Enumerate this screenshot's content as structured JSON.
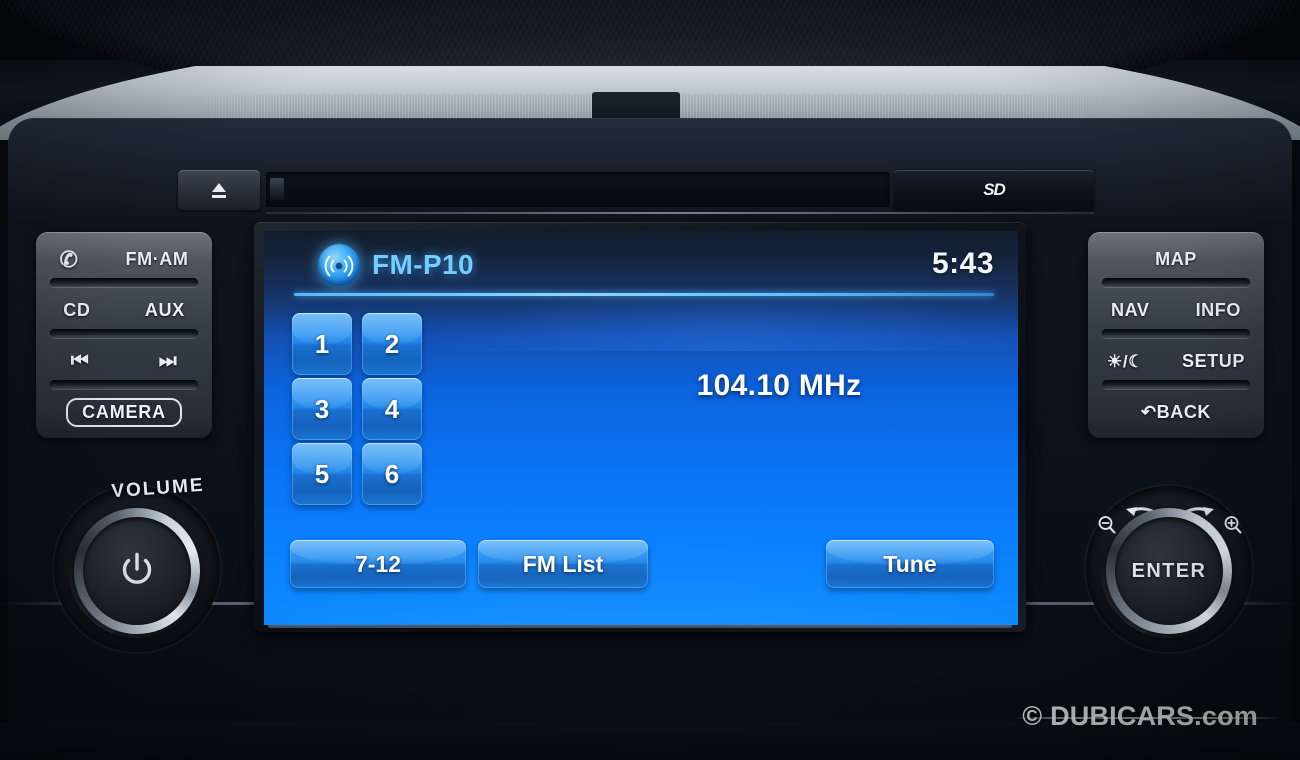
{
  "device": {
    "name": "car-infotainment-head-unit",
    "slot_bar": {
      "eject_label": "eject-icon",
      "sd_label": "SD"
    }
  },
  "screen": {
    "status": {
      "source_icon": "radio-wave-icon",
      "station_label": "FM-P10",
      "clock": "5:43"
    },
    "frequency": "104.10 MHz",
    "presets": [
      {
        "label": "1"
      },
      {
        "label": "2"
      },
      {
        "label": "3"
      },
      {
        "label": "4"
      },
      {
        "label": "5"
      },
      {
        "label": "6"
      }
    ],
    "bottom_buttons": [
      {
        "name": "presets-7-12-button",
        "label": "7-12"
      },
      {
        "name": "fm-list-button",
        "label": "FM List"
      },
      {
        "name": "tune-button",
        "label": "Tune"
      }
    ],
    "colors": {
      "screen_top": "#121c2c",
      "screen_bottom": "#0d8bff",
      "station_text": "#75cdff",
      "rule": "#53b9ff",
      "button_face": "#2c92f0"
    }
  },
  "left_panel": {
    "rows": [
      {
        "items": [
          {
            "name": "phone-button",
            "label": "✆",
            "type": "icon"
          },
          {
            "name": "fm-am-button",
            "label": "FM·AM",
            "type": "text"
          }
        ]
      },
      {
        "items": [
          {
            "name": "cd-button",
            "label": "CD",
            "type": "text"
          },
          {
            "name": "aux-button",
            "label": "AUX",
            "type": "text"
          }
        ]
      },
      {
        "items": [
          {
            "name": "previous-track-button",
            "label": "⏮",
            "type": "icon"
          },
          {
            "name": "next-track-button",
            "label": "⏭",
            "type": "icon"
          }
        ]
      },
      {
        "items": [
          {
            "name": "camera-button",
            "label": "CAMERA",
            "type": "boxed"
          }
        ]
      }
    ]
  },
  "right_panel": {
    "rows": [
      {
        "items": [
          {
            "name": "map-button",
            "label": "MAP",
            "type": "solo"
          }
        ]
      },
      {
        "items": [
          {
            "name": "nav-button",
            "label": "NAV",
            "type": "text"
          },
          {
            "name": "info-button",
            "label": "INFO",
            "type": "text"
          }
        ]
      },
      {
        "items": [
          {
            "name": "day-night-button",
            "label": "☀/☾",
            "type": "icon"
          },
          {
            "name": "setup-button",
            "label": "SETUP",
            "type": "text"
          }
        ]
      },
      {
        "items": [
          {
            "name": "back-button",
            "label": "↶BACK",
            "type": "solo"
          }
        ]
      }
    ]
  },
  "knobs": {
    "volume": {
      "caption": "VOLUME",
      "center_icon": "power-icon"
    },
    "enter": {
      "label": "ENTER",
      "zoom_out_icon": "zoom-out-icon",
      "zoom_in_icon": "zoom-in-icon",
      "rotate_left_icon": "arrow-left-icon",
      "rotate_right_icon": "arrow-right-icon"
    }
  },
  "watermark": {
    "text": "© DUBICARS.com"
  }
}
